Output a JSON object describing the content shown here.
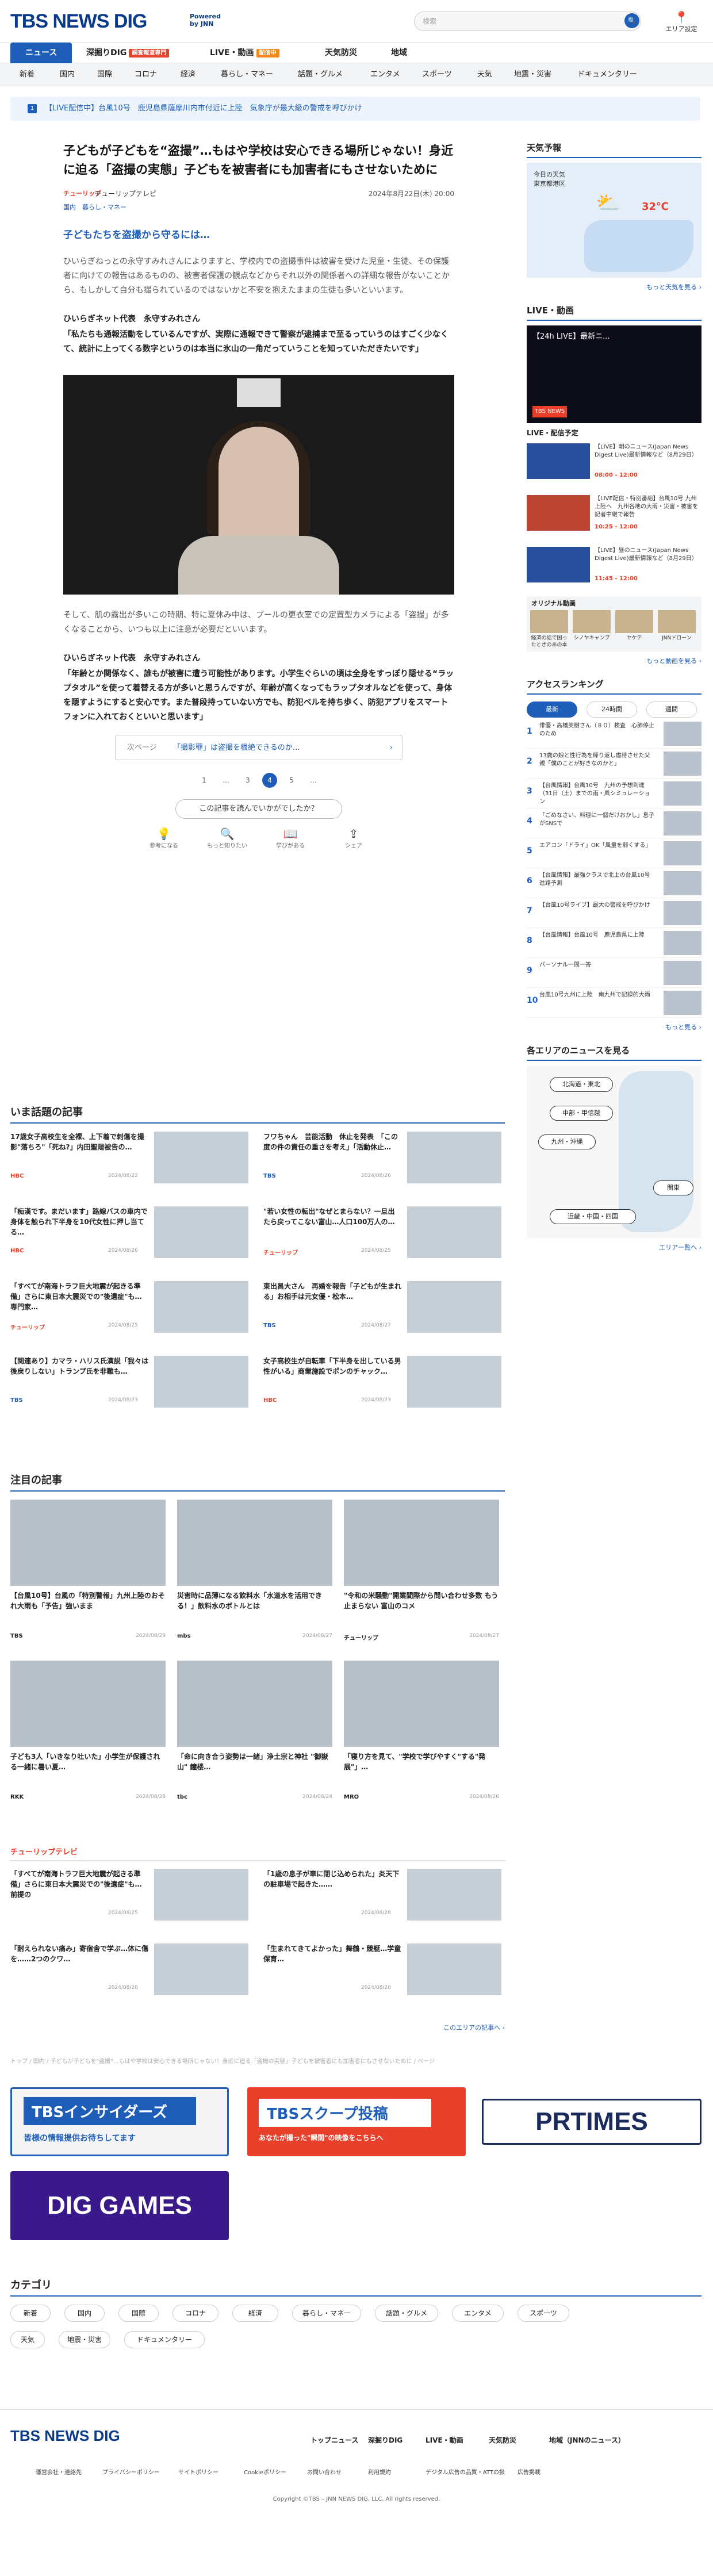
{
  "header": {
    "logo": "TBS NEWS DIG",
    "powered1": "Powered",
    "powered2": "by JNN",
    "search_placeholder": "検索",
    "weather_label": "エリア設定"
  },
  "nav_main": [
    {
      "label": "ニュース"
    },
    {
      "label": "深掘りDIG",
      "tag": "調査報道専門"
    },
    {
      "label": "LIVE・動画",
      "tag": "配信中"
    },
    {
      "label": "天気防災"
    },
    {
      "label": "地域"
    }
  ],
  "nav_sub": [
    "新着",
    "国内",
    "国際",
    "コロナ",
    "経済",
    "暮らし・マネー",
    "話題・グルメ",
    "エンタメ",
    "スポーツ",
    "天気",
    "地震・災害",
    "ドキュメンタリー"
  ],
  "ticker": {
    "num": "1",
    "text": "【LIVE配信中】台風10号　鹿児島県薩摩川内市付近に上陸　気象庁が最大級の警戒を呼びかけ"
  },
  "article": {
    "title": "子どもが子どもを“盗撮”…もはや学校は安心できる場所じゃない！身近に迫る「盗撮の実態」子どもを被害者にも加害者にもさせないために",
    "brand": "チューリップ",
    "source": "チューリップテレビ",
    "date": "2024年8月22日(木) 20:00",
    "category": "国内　暮らし・マネー",
    "subtitle": "子どもたちを盗撮から守るには…",
    "para1": "ひいらぎねっとの永守すみれさんによりますと、学校内での盗撮事件は被害を受けた児童・生徒、その保護者に向けての報告はあるものの、被害者保護の観点などからそれ以外の関係者への詳細な報告がないことから、もしかして自分も撮られているのではないかと不安を抱えたままの生徒も多いといいます。",
    "q1label": "ひいらぎネット代表　永守すみれさん",
    "q1": "「私たちも通報活動をしているんですが、実際に通報できて警察が逮捕まで至るっていうのはすごく少なくて、統計に上ってくる数字というのは本当に氷山の一角だっていうことを知っていただきたいです」",
    "para2": "そして、肌の露出が多いこの時期、特に夏休み中は、プールの更衣室での定置型カメラによる「盗撮」が多くなることから、いつも以上に注意が必要だといいます。",
    "q2label": "ひいらぎネット代表　永守すみれさん",
    "q2": "「年齢とか関係なく、誰もが被害に遭う可能性があります。小学生ぐらいの頃は全身をすっぽり隠せる“ラップタオル”を使って着替える方が多いと思うんですが、年齢が高くなってもラップタオルなどを使って、身体を隠すようにすると安心です。また普段持っていない方でも、防犯ベルを持ち歩く、防犯アプリをスマートフォンに入れておくといいと思います」",
    "pager_label": "次ページ",
    "pager_text": "「撮影罪」は盗撮を根絶できるのか…",
    "pages": [
      "1",
      "…",
      "3",
      "4",
      "5",
      "…"
    ],
    "feedback": "この記事を読んでいかがでしたか？",
    "fb_icons": [
      {
        "g": "💡",
        "l": "参考になる"
      },
      {
        "g": "🔍",
        "l": "もっと知りたい"
      },
      {
        "g": "📖",
        "l": "学びがある"
      },
      {
        "g": "⇪",
        "l": "シェア"
      }
    ]
  },
  "side": {
    "weather_title": "天気予報",
    "weather_a": "今日の天気",
    "weather_b": "東京都港区",
    "weather_temp": "32℃",
    "weather_more": "もっと天気を見る ›",
    "live_title": "LIVE・動画",
    "live_video": "【24h LIVE】最新ニ...",
    "live_ch": "TBS NEWS",
    "sched_title": "LIVE・配信予定",
    "schedule": [
      {
        "text": "【LIVE】朝のニュース(Japan News Digest Live)最新情報など（8月29日）",
        "time": "08:00 - 12:00"
      },
      {
        "text": "【LIVE配信・特別番組】台風10号 九州上陸へ　九州各地の大雨・災害・被害を記者中継で報告",
        "time": "10:25 - 12:00"
      },
      {
        "text": "【LIVE】昼のニュース(Japan News Digest Live)最新情報など（8月29日）",
        "time": "11:45 - 12:00"
      }
    ],
    "orig_title": "オリジナル動画",
    "orig": [
      "経済の話で困ったときのあの本",
      "シノヤキャンプ",
      "ヤケテ",
      "JNNドローン"
    ],
    "orig_more": "もっと動画を見る ›",
    "rank_title": "アクセスランキング",
    "rank_tabs": [
      "最新",
      "24時間",
      "週間"
    ],
    "ranking": [
      "俳優・高橋英樹さん（８０）検査　心肺停止のため",
      "13歳の娘と性行為を繰り返し虐待させた父親「僕のことが好きなのかと」",
      "【台風情報】台風10号　九州の予想到達（31日（土）までの雨・風シミュレーション",
      "「ごめなさい、料理に一個だけおかし」息子がSNSで",
      "エアコン「ドライ」OK「風量を弱くする」",
      "【台風情報】最強クラスで北上の台風10号進路予測",
      "【台風10号ライブ】最大の警戒を呼びかけ",
      "【台風情報】台風10号　鹿児島県に上陸",
      "パーソナル一問一答",
      "台風10号九州に上陸　南九州で記録的大雨"
    ],
    "rank_more": "もっと見る ›",
    "area_title": "各エリアのニュースを見る",
    "areas": [
      "北海道・東北",
      "中部・甲信越",
      "九州・沖縄",
      "関東",
      "近畿・中国・四国"
    ],
    "area_more": "エリア一覧へ ›"
  },
  "topics_title": "いま話題の記事",
  "topics": [
    {
      "t": "17歳女子高校生を全裸、上下着で刺傷を撮影\"落ちろ\"「死ね?」内田聖陽被告の…",
      "b": "HBC",
      "d": "2024/08/22"
    },
    {
      "t": "フワちゃん　芸能活動　休止を発表　「この度の件の責任の重さを考え」「活動休止…",
      "b": "TBS",
      "d": "2024/08/26"
    },
    {
      "t": "「痴漢です。まだいます」路線バスの車内で身体を触られ下半身を10代女性に押し当てる…",
      "b": "HBC",
      "d": "2024/08/26"
    },
    {
      "t": "\"若い女性の転出\"なぜとまらない？一旦出たら戻ってこない富山…人口100万人の…",
      "b": "チューリップ",
      "d": "2024/08/25"
    },
    {
      "t": "「すべてが南海トラフ巨大地震が起きる準備」さらに東日本大震災での\"後遺症\"も…専門家…",
      "b": "チューリップ",
      "d": "2024/08/25"
    },
    {
      "t": "東出昌大さん　再婚を報告「子どもが生まれる」お相手は元女優・松本…",
      "b": "TBS",
      "d": "2024/08/27"
    },
    {
      "t": "【関連あり】カマラ・ハリス氏演説「我々は後戻りしない」トランプ氏を非難も…",
      "b": "TBS",
      "d": "2024/08/23"
    },
    {
      "t": "女子高校生が自転車「下半身を出している男性がいる」商業施設でポンのチャック…",
      "b": "HBC",
      "d": "2024/08/23"
    }
  ],
  "featured_title": "注目の記事",
  "featured": [
    {
      "t": "【台風10号】台風の「特別警報」九州上陸のおそれ大雨も「予告」強いまま",
      "b": "TBS",
      "d": "2024/08/29"
    },
    {
      "t": "災害時に品薄になる飲料水「水道水を活用できる！」飲料水のボトルとは",
      "b": "mbs",
      "d": "2024/08/27"
    },
    {
      "t": "\"令和の米騒動\"開業間際から問い合わせ多数 もう止まらない 富山のコメ",
      "b": "チューリップ",
      "d": "2024/08/27"
    },
    {
      "t": "子ども3人「いきなり吐いた」小学生が保護される一緒に暑い夏…",
      "b": "RKK",
      "d": "2024/08/28"
    },
    {
      "t": "「命に向き合う姿勢は一緒」浄土宗と神社 \"御嶽山\" 鐘楼…",
      "b": "tbc",
      "d": "2024/08/24"
    },
    {
      "t": "「寝り方を見て、\"学校で学びやすく\"する\"発展\"」…",
      "b": "MRO",
      "d": "2024/08/26"
    }
  ],
  "tulip_label": "チューリップテレビ",
  "tulip": [
    {
      "t": "「すべてが南海トラフ巨大地震が起きる準備」さらに東日本大震災での\"後遺症\"も…前提の",
      "d": "2024/08/25"
    },
    {
      "t": "「1歳の息子が車に閉じ込められた」炎天下の駐車場で起きた……",
      "d": "2024/08/28"
    },
    {
      "t": "「耐えられない痛み」寄宿舎で学ぶ…体に傷を……2つのクワ…",
      "d": "2024/08/20"
    },
    {
      "t": "「生まれてきてよかった」舞鶴・競艇…学童保育…",
      "d": "2024/08/20"
    }
  ],
  "tulip_more": "このエリアの記事へ ›",
  "breadcrumb": "トップ / 国内 / 子どもが子どもを\"盗撮\"…もはや学校は安心できる場所じゃない！身近に迫る「盗撮の実態」子どもを被害者にも加害者にもさせないために / ページ",
  "banners": {
    "insiders": "TBSインサイダーズ",
    "insiders_sub": "皆様の情報提供お待ちしてます",
    "scoop": "TBSスクープ投稿",
    "scoop_sub": "あなたが撮った\"瞬間\"の映像をこちらへ",
    "prtimes": "PRTIMES",
    "dig": "DIG GAMES"
  },
  "category_title": "カテゴリ",
  "categories": [
    "新着",
    "国内",
    "国際",
    "コロナ",
    "経済",
    "暮らし・マネー",
    "話題・グルメ",
    "エンタメ",
    "スポーツ",
    "天気",
    "地震・災害",
    "ドキュメンタリー"
  ],
  "footer": {
    "logo": "TBS NEWS DIG",
    "links": [
      "トップニュース",
      "深掘りDIG",
      "LIVE・動画",
      "天気防災",
      "地域（JNNのニュース）"
    ],
    "sub": [
      "運営会社・連絡先",
      "プライバシーポリシー",
      "サイトポリシー",
      "Cookieポリシー",
      "お問い合わせ",
      "利用規約",
      "デジタル広告の品質・ATTの扱",
      "広告掲載"
    ],
    "copy": "Copyright ©TBS – JNN NEWS DIG, LLC. All rights reserved."
  }
}
